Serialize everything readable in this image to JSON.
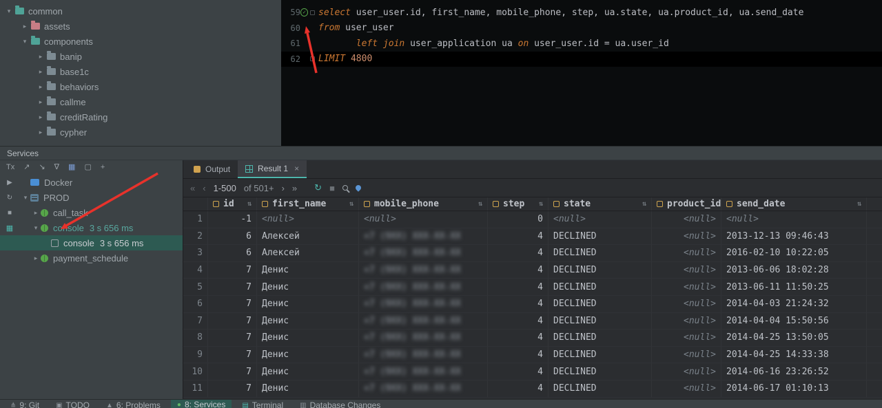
{
  "colors": {
    "panel": "#3c4245",
    "editor_bg": "#0a0c0d",
    "grid_bg": "#2b2d30",
    "accent_teal": "#4db6ac",
    "selection": "#2d5a52",
    "keyword": "#cc7832",
    "number_token": "#cf8e6d",
    "null_text": "#7a828a",
    "annotation_arrow": "#e8322b"
  },
  "project_tree": {
    "items": [
      {
        "label": "common",
        "indent": 0,
        "state": "expanded",
        "folder": "teal"
      },
      {
        "label": "assets",
        "indent": 1,
        "state": "collapsed",
        "folder": "pink"
      },
      {
        "label": "components",
        "indent": 1,
        "state": "expanded",
        "folder": "teal"
      },
      {
        "label": "banip",
        "indent": 2,
        "state": "collapsed",
        "folder": "gray"
      },
      {
        "label": "base1c",
        "indent": 2,
        "state": "collapsed",
        "folder": "gray"
      },
      {
        "label": "behaviors",
        "indent": 2,
        "state": "collapsed",
        "folder": "gray"
      },
      {
        "label": "callme",
        "indent": 2,
        "state": "collapsed",
        "folder": "gray"
      },
      {
        "label": "creditRating",
        "indent": 2,
        "state": "collapsed",
        "folder": "gray"
      },
      {
        "label": "cypher",
        "indent": 2,
        "state": "collapsed",
        "folder": "gray"
      }
    ]
  },
  "editor": {
    "lines": [
      {
        "num": "59",
        "check": true,
        "marker": true,
        "current": false,
        "segments": [
          {
            "t": "select ",
            "s": "kw"
          },
          {
            "t": "user_user.id, first_name, mobile_phone, step, ua.state, ua.product_id, ua.send_date",
            "s": "plain"
          }
        ]
      },
      {
        "num": "60",
        "check": false,
        "marker": false,
        "current": false,
        "segments": [
          {
            "t": "from ",
            "s": "kw"
          },
          {
            "t": "user_user",
            "s": "plain"
          }
        ]
      },
      {
        "num": "61",
        "check": false,
        "marker": false,
        "current": false,
        "segments": [
          {
            "t": "       ",
            "s": "plain"
          },
          {
            "t": "left join ",
            "s": "kw"
          },
          {
            "t": "user_application ua ",
            "s": "plain"
          },
          {
            "t": "on ",
            "s": "kw"
          },
          {
            "t": "user_user.id = ua.user_id",
            "s": "plain"
          }
        ]
      },
      {
        "num": "62",
        "check": false,
        "marker": true,
        "current": true,
        "segments": [
          {
            "t": "LIMIT ",
            "s": "kw"
          },
          {
            "t": "4800",
            "s": "num"
          }
        ]
      }
    ]
  },
  "services": {
    "title": "Services",
    "toolbar": [
      {
        "name": "tx-mode",
        "glyph": "Tx",
        "tint": ""
      },
      {
        "name": "expand-icon",
        "glyph": "↗",
        "tint": ""
      },
      {
        "name": "collapse-icon",
        "glyph": "↘",
        "tint": ""
      },
      {
        "name": "filter-icon",
        "glyph": "∇",
        "tint": ""
      },
      {
        "name": "columns-icon",
        "glyph": "▦",
        "tint": "blue"
      },
      {
        "name": "frame-icon",
        "glyph": "▢",
        "tint": ""
      },
      {
        "name": "add-icon",
        "glyph": "+",
        "tint": ""
      }
    ],
    "strip": [
      {
        "name": "run-icon",
        "glyph": "▶",
        "tint": ""
      },
      {
        "name": "rerun-icon",
        "glyph": "↻",
        "tint": ""
      },
      {
        "name": "stop-icon",
        "glyph": "■",
        "tint": ""
      },
      {
        "name": "services-tool-icon",
        "glyph": "▦",
        "tint": "teal"
      }
    ],
    "tree": [
      {
        "label": "Docker",
        "duration": "",
        "icon": "docker",
        "indent": 0,
        "state": "",
        "selected": false,
        "tint": ""
      },
      {
        "label": "PROD",
        "duration": "",
        "icon": "db",
        "indent": 0,
        "state": "expanded",
        "selected": false,
        "tint": ""
      },
      {
        "label": "call_task",
        "duration": "",
        "icon": "bug",
        "indent": 1,
        "state": "collapsed",
        "selected": false,
        "tint": ""
      },
      {
        "label": "console",
        "duration": "3 s 656 ms",
        "icon": "bug",
        "indent": 1,
        "state": "expanded",
        "selected": false,
        "tint": "tint"
      },
      {
        "label": "console",
        "duration": "3 s 656 ms",
        "icon": "console",
        "indent": 2,
        "state": "",
        "selected": true,
        "tint": ""
      },
      {
        "label": "payment_schedule",
        "duration": "",
        "icon": "bug",
        "indent": 1,
        "state": "collapsed",
        "selected": false,
        "tint": ""
      }
    ]
  },
  "results": {
    "tabs": [
      {
        "label": "Output",
        "icon": "output",
        "active": false,
        "closable": false
      },
      {
        "label": "Result 1",
        "icon": "grid",
        "active": true,
        "closable": true
      }
    ],
    "tab_close_glyph": "×",
    "pagination": {
      "first": "«",
      "prev": "‹",
      "range": "1-500",
      "of": "of 501+",
      "next": "›",
      "last": "»",
      "refresh_glyph": "↻",
      "stop_glyph": "■"
    },
    "grid": {
      "sort_glyph": "⇅",
      "columns": [
        {
          "label": "id",
          "align": "right"
        },
        {
          "label": "first_name",
          "align": "left"
        },
        {
          "label": "mobile_phone",
          "align": "left"
        },
        {
          "label": "step",
          "align": "right"
        },
        {
          "label": "state",
          "align": "left"
        },
        {
          "label": "product_id",
          "align": "right"
        },
        {
          "label": "send_date",
          "align": "left"
        }
      ],
      "rows": [
        [
          "1",
          "-1",
          "<null>",
          "<null>",
          "0",
          "<null>",
          "<null>",
          "<null>"
        ],
        [
          "2",
          "6",
          "Алексей",
          "+7 (9XX) XXX-XX-XX",
          "4",
          "DECLINED",
          "<null>",
          "2013-12-13 09:46:43"
        ],
        [
          "3",
          "6",
          "Алексей",
          "+7 (9XX) XXX-XX-XX",
          "4",
          "DECLINED",
          "<null>",
          "2016-02-10 10:22:05"
        ],
        [
          "4",
          "7",
          "Денис",
          "+7 (9XX) XXX-XX-XX",
          "4",
          "DECLINED",
          "<null>",
          "2013-06-06 18:02:28"
        ],
        [
          "5",
          "7",
          "Денис",
          "+7 (9XX) XXX-XX-XX",
          "4",
          "DECLINED",
          "<null>",
          "2013-06-11 11:50:25"
        ],
        [
          "6",
          "7",
          "Денис",
          "+7 (9XX) XXX-XX-XX",
          "4",
          "DECLINED",
          "<null>",
          "2014-04-03 21:24:32"
        ],
        [
          "7",
          "7",
          "Денис",
          "+7 (9XX) XXX-XX-XX",
          "4",
          "DECLINED",
          "<null>",
          "2014-04-04 15:50:56"
        ],
        [
          "8",
          "7",
          "Денис",
          "+7 (9XX) XXX-XX-XX",
          "4",
          "DECLINED",
          "<null>",
          "2014-04-25 13:50:05"
        ],
        [
          "9",
          "7",
          "Денис",
          "+7 (9XX) XXX-XX-XX",
          "4",
          "DECLINED",
          "<null>",
          "2014-04-25 14:33:38"
        ],
        [
          "10",
          "7",
          "Денис",
          "+7 (9XX) XXX-XX-XX",
          "4",
          "DECLINED",
          "<null>",
          "2014-06-16 23:26:52"
        ],
        [
          "11",
          "7",
          "Денис",
          "+7 (9XX) XXX-XX-XX",
          "4",
          "DECLINED",
          "<null>",
          "2014-06-17 01:10:13"
        ]
      ]
    }
  },
  "status_bar": {
    "items": [
      {
        "label": "9: Git",
        "icon": "⋔",
        "tint": "",
        "active": false
      },
      {
        "label": "TODO",
        "icon": "▣",
        "tint": "",
        "active": false
      },
      {
        "label": "6: Problems",
        "icon": "▲",
        "tint": "",
        "active": false
      },
      {
        "label": "8: Services",
        "icon": "●",
        "tint": "green",
        "active": true
      },
      {
        "label": "Terminal",
        "icon": "▤",
        "tint": "teal",
        "active": false
      },
      {
        "label": "Database Changes",
        "icon": "▥",
        "tint": "",
        "active": false
      }
    ]
  }
}
